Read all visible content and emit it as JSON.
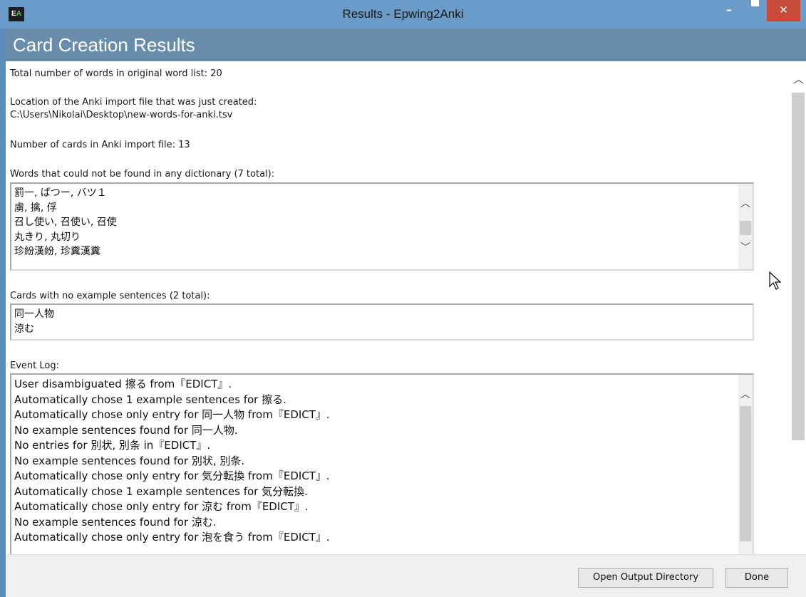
{
  "window": {
    "title": "Results - Epwing2Anki",
    "icon_letters": "E",
    "icon_sub": "A",
    "minimize_glyph": "–",
    "close_glyph": "✕"
  },
  "header": {
    "title": "Card Creation Results"
  },
  "summary": {
    "total_words": "Total number of words in original word list: 20",
    "location_label": "Location of the Anki import file that was just created:",
    "location_path": "C:\\Users\\Nikolai\\Desktop\\new-words-for-anki.tsv",
    "cards_count": "Number of cards in Anki import file: 13"
  },
  "not_found": {
    "label": "Words that could not be found in any dictionary (7 total):",
    "lines": [
      "罰一, ばつー, バツ１",
      "虜, 擒, 俘",
      "召し使い, 召使い, 召使",
      "丸きり, 丸切り",
      "珍紛漢紛, 珍糞漢糞"
    ]
  },
  "no_examples": {
    "label": "Cards with no example sentences (2 total):",
    "lines": [
      "同一人物",
      "涼む"
    ]
  },
  "event_log": {
    "label": "Event Log:",
    "lines": [
      "User disambiguated 擦る from『EDICT』.",
      "Automatically chose 1 example sentences for 擦る.",
      "Automatically chose only entry for 同一人物 from『EDICT』.",
      "No example sentences found for 同一人物.",
      "No entries for 別状, 別条 in『EDICT』.",
      "No example sentences found for 別状, 別条.",
      "Automatically chose only entry for 気分転換 from『EDICT』.",
      "Automatically chose 1 example sentences for 気分転換.",
      "Automatically chose only entry for 涼む from『EDICT』.",
      "No example sentences found for 涼む.",
      "Automatically chose only entry for 泡を食う from『EDICT』."
    ]
  },
  "buttons": {
    "open_output": "Open Output Directory",
    "done": "Done"
  },
  "colors": {
    "titlebar": "#6b9bc8",
    "header_band": "#6a8cab",
    "close_button": "#c74a3a"
  }
}
